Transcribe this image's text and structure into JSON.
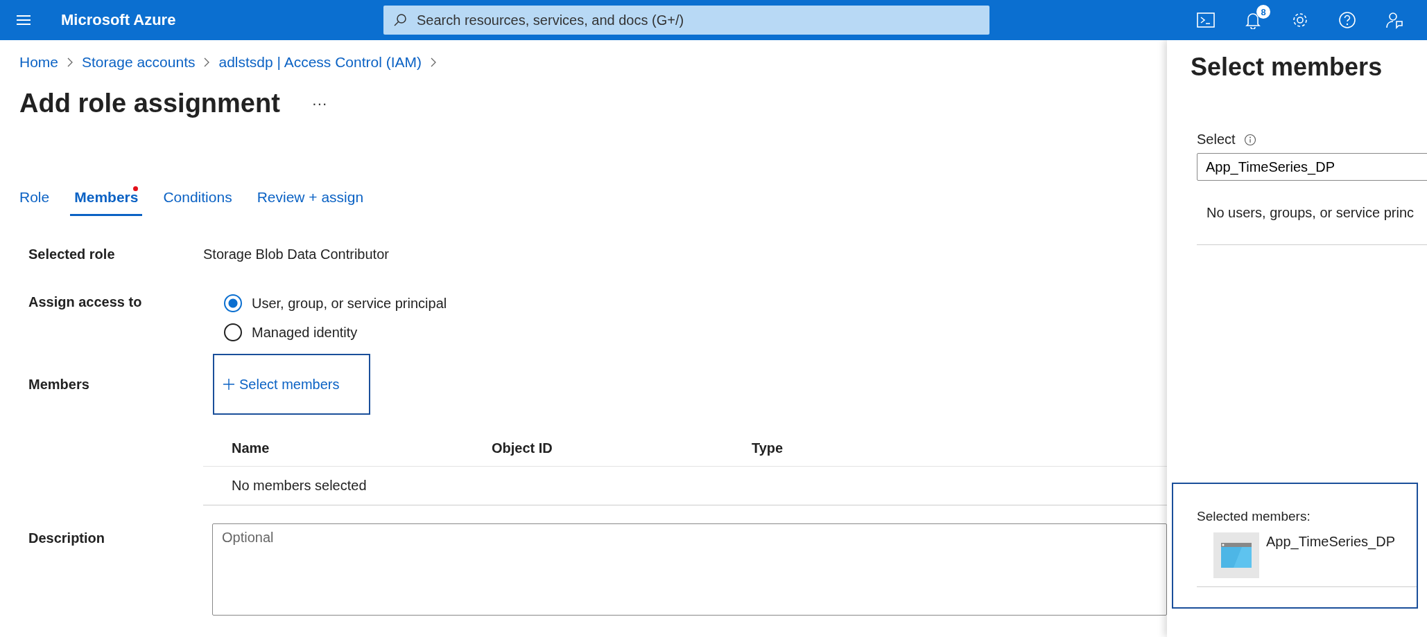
{
  "topbar": {
    "brand": "Microsoft Azure",
    "search": {
      "placeholder": "Search resources, services, and docs (G+/)"
    },
    "notification_count": "8"
  },
  "breadcrumb": [
    "Home",
    "Storage accounts",
    "adlstsdp | Access Control (IAM)"
  ],
  "title": "Add role assignment",
  "more": "···",
  "tabs": [
    {
      "label": "Role",
      "selected": false,
      "flagged": false
    },
    {
      "label": "Members",
      "selected": true,
      "flagged": true
    },
    {
      "label": "Conditions",
      "selected": false,
      "flagged": false
    },
    {
      "label": "Review + assign",
      "selected": false,
      "flagged": false
    }
  ],
  "selected_role": {
    "label": "Selected role",
    "value": "Storage Blob Data Contributor"
  },
  "assign_access": {
    "label": "Assign access to",
    "options": [
      {
        "label": "User, group, or service principal",
        "selected": true
      },
      {
        "label": "Managed identity",
        "selected": false
      }
    ]
  },
  "members": {
    "label": "Members",
    "button": "Select members",
    "highlighted": true,
    "columns": [
      "Name",
      "Object ID",
      "Type"
    ],
    "empty": "No members selected"
  },
  "description": {
    "label": "Description",
    "placeholder": "Optional"
  },
  "panel": {
    "title": "Select members",
    "select_label": "Select",
    "search_value": "App_TimeSeries_DP",
    "results_message": "No users, groups, or service princ",
    "selected_label": "Selected members:",
    "highlighted": true,
    "selected": [
      {
        "name": "App_TimeSeries_DP"
      }
    ]
  }
}
